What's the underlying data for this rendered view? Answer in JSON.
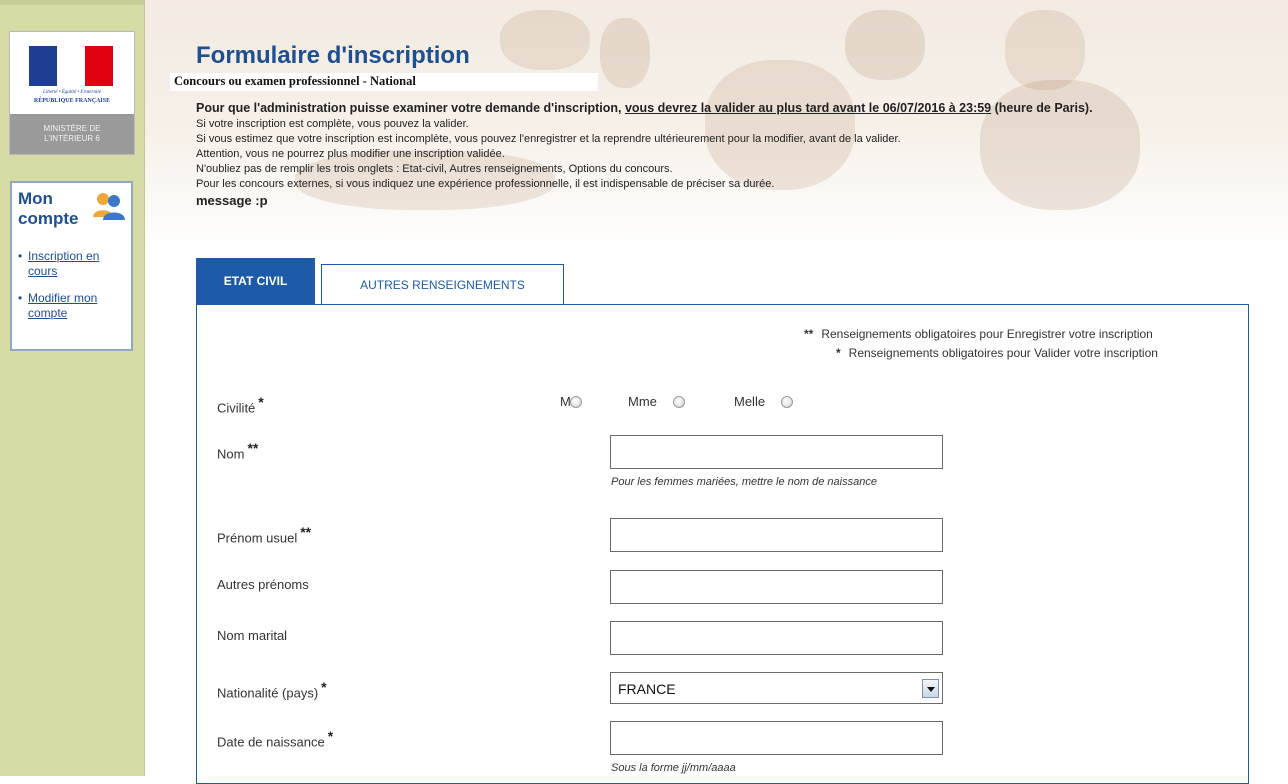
{
  "logo": {
    "motto": "Liberté • Égalité • Fraternité",
    "republic": "RÉPUBLIQUE FRANÇAISE",
    "ministry_line1": "MINISTÈRE DE",
    "ministry_line2": "L'INTÉRIEUR 6"
  },
  "account": {
    "title": "Mon compte",
    "icon": "users-icon",
    "links": [
      {
        "label": "Inscription en cours"
      },
      {
        "label": "Modifier mon compte"
      }
    ]
  },
  "header": {
    "title": "Formulaire d'inscription",
    "subtitle": "Concours ou examen professionnel - National"
  },
  "intro": {
    "lead_before": "Pour que l'administration puisse examiner votre demande d'inscription, ",
    "lead_underlined": "vous devrez la valider au plus tard avant le 06/07/2016 à 23:59",
    "lead_after": " (heure de Paris).",
    "lines": [
      "Si votre inscription est complète, vous pouvez la valider.",
      "Si vous estimez que votre inscription est incomplète, vous pouvez l'enregistrer et la reprendre ultérieurement pour la modifier, avant de la valider.",
      "Attention, vous ne pourrez plus modifier une inscription validée.",
      "N'oubliez pas de remplir les trois onglets : Etat-civil, Autres renseignements, Options du concours.",
      "Pour les concours externes, si vous indiquez une expérience professionnelle, il est indispensable de préciser sa durée."
    ],
    "message": "message :p"
  },
  "tabs": [
    {
      "label": "ETAT CIVIL",
      "active": true
    },
    {
      "label": "AUTRES RENSEIGNEMENTS",
      "active": false
    }
  ],
  "legend": {
    "double_star": "**",
    "double_text": "Renseignements obligatoires pour Enregistrer votre inscription",
    "single_star": "*",
    "single_text": "Renseignements obligatoires pour Valider votre inscription"
  },
  "form": {
    "civilite": {
      "label": "Civilité",
      "req": "*",
      "options": [
        "M",
        "Mme",
        "Melle"
      ]
    },
    "nom": {
      "label": "Nom",
      "req": "**",
      "value": "",
      "hint": "Pour les femmes mariées, mettre le nom de naissance"
    },
    "prenom": {
      "label": "Prénom usuel",
      "req": "**",
      "value": ""
    },
    "autres_prenoms": {
      "label": "Autres prénoms",
      "value": ""
    },
    "nom_marital": {
      "label": "Nom marital",
      "value": ""
    },
    "nationalite": {
      "label": "Nationalité (pays)",
      "req": "*",
      "value": "FRANCE"
    },
    "naissance": {
      "label": "Date de naissance",
      "req": "*",
      "value": "",
      "hint": "Sous la forme jj/mm/aaaa"
    }
  },
  "colors": {
    "brand_blue": "#1d5ba8",
    "title_blue": "#1d4f91",
    "sidebar": "#d7dca6",
    "flag_blue": "#1c3f94",
    "flag_red": "#e1000f"
  }
}
